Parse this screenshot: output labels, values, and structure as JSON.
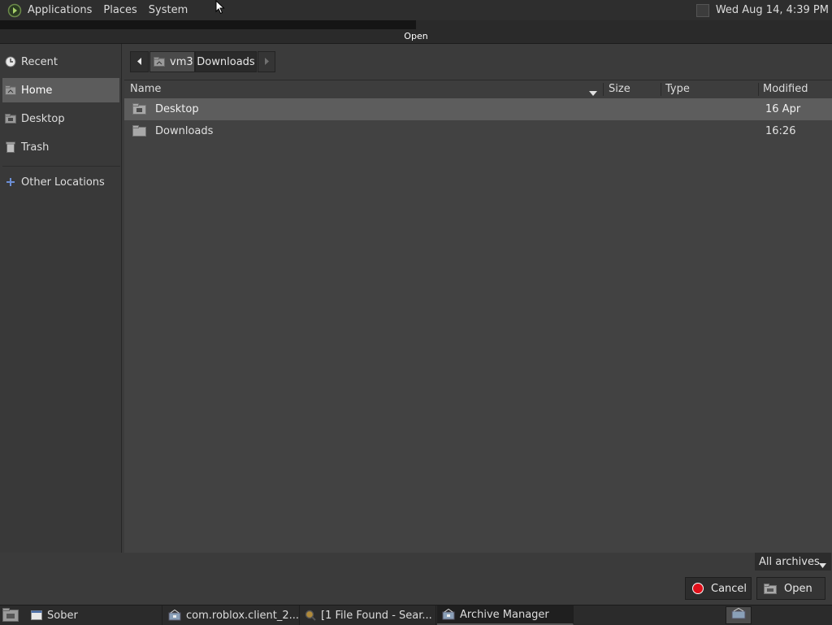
{
  "top_panel": {
    "menus": [
      "Applications",
      "Places",
      "System"
    ],
    "clock": "Wed Aug 14,  4:39 PM"
  },
  "dialog": {
    "title": "Open",
    "sidebar": {
      "items": [
        {
          "label": "Recent",
          "icon": "recent-icon"
        },
        {
          "label": "Home",
          "icon": "home-folder-icon",
          "selected": true
        },
        {
          "label": "Desktop",
          "icon": "desktop-folder-icon"
        },
        {
          "label": "Trash",
          "icon": "trash-icon"
        },
        {
          "label": "Other Locations",
          "icon": "plus-icon"
        }
      ]
    },
    "pathbar": {
      "segments": [
        "vm3",
        "Downloads"
      ]
    },
    "columns": {
      "name": "Name",
      "size": "Size",
      "type": "Type",
      "modified": "Modified"
    },
    "files": [
      {
        "name": "Desktop",
        "size": "",
        "type": "",
        "modified": "16 Apr",
        "selected": true
      },
      {
        "name": "Downloads",
        "size": "",
        "type": "",
        "modified": "16:26",
        "selected": false
      }
    ],
    "filter": "All archives",
    "buttons": {
      "cancel": "Cancel",
      "open": "Open"
    }
  },
  "taskbar": {
    "tasks": [
      {
        "label": "Sober"
      },
      {
        "label": "com.roblox.client_2...."
      },
      {
        "label": "[1 File Found - Sear..."
      },
      {
        "label": "Archive Manager",
        "active": true
      }
    ]
  },
  "colors": {
    "panel_bg": "#2e2e2e",
    "dialog_bg": "#3b3b3b",
    "selected_row": "#5d5d5d",
    "cancel_icon": "#e0101a"
  }
}
